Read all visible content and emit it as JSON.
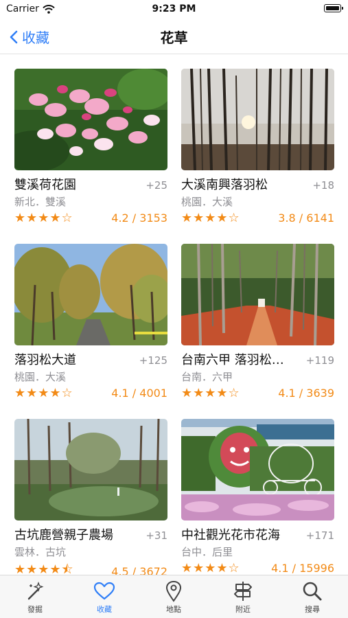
{
  "status_bar": {
    "carrier": "Carrier",
    "time": "9:23 PM"
  },
  "nav": {
    "back_label": "收藏",
    "title": "花草"
  },
  "cards": [
    {
      "name": "雙溪荷花園",
      "extra": "+25",
      "location": "新北．雙溪",
      "stars": "★★★★☆",
      "rating": "4.2 / 3153",
      "photo": "flower-photo"
    },
    {
      "name": "大溪南興落羽松",
      "extra": "+18",
      "location": "桃園．大溪",
      "stars": "★★★★☆",
      "rating": "3.8 / 6141",
      "photo": "cypress-forest-photo"
    },
    {
      "name": "落羽松大道",
      "extra": "+125",
      "location": "桃園．大溪",
      "stars": "★★★★☆",
      "rating": "4.1 / 4001",
      "photo": "tree-avenue-photo"
    },
    {
      "name": "台南六甲 落羽松…",
      "extra": "+119",
      "location": "台南．六甲",
      "stars": "★★★★☆",
      "rating": "4.1 / 3639",
      "photo": "red-cypress-path-photo"
    },
    {
      "name": "古坑鹿營親子農場",
      "extra": "+31",
      "location": "雲林．古坑",
      "stars": "★★★★⯪",
      "rating": "4.5 / 3672",
      "photo": "pond-photo"
    },
    {
      "name": "中社觀光花市花海",
      "extra": "+171",
      "location": "台中．后里",
      "stars": "★★★★☆",
      "rating": "4.1 / 15996",
      "photo": "flower-garden-carriage-photo"
    }
  ],
  "tabs": [
    {
      "label": "發掘",
      "icon": "magic-wand-icon"
    },
    {
      "label": "收藏",
      "icon": "heart-icon",
      "active": true
    },
    {
      "label": "地點",
      "icon": "map-pin-icon"
    },
    {
      "label": "附近",
      "icon": "signpost-icon"
    },
    {
      "label": "搜尋",
      "icon": "search-icon"
    }
  ],
  "colors": {
    "accent": "#2f7ef7",
    "rating": "#f28a16",
    "secondary_text": "#8e8e93"
  }
}
